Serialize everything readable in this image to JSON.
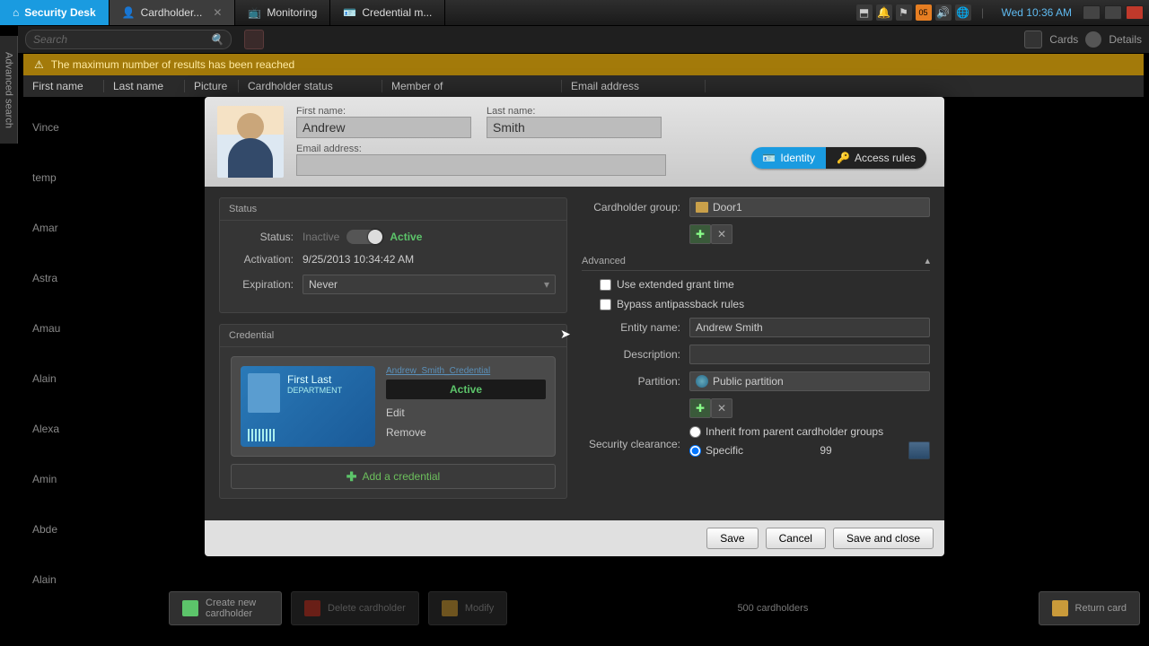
{
  "taskbar": {
    "home": "Security Desk",
    "tabs": [
      "Cardholder...",
      "Monitoring",
      "Credential m..."
    ],
    "clock": "Wed 10:36 AM"
  },
  "secondbar": {
    "search_placeholder": "Search",
    "cards": "Cards",
    "details": "Details"
  },
  "warning": "The maximum number of results has been reached",
  "sidebar": "Advanced search",
  "table": {
    "headers": [
      "First name",
      "Last name",
      "Picture",
      "Cardholder status",
      "Member of",
      "Email address"
    ],
    "rows": [
      "Vince",
      "temp",
      "Amar",
      "Astra",
      "Amau",
      "Alain",
      "Alexa",
      "Amin",
      "Abde",
      "Alain"
    ]
  },
  "modal": {
    "first_name_label": "First name:",
    "first_name": "Andrew",
    "last_name_label": "Last name:",
    "last_name": "Smith",
    "email_label": "Email address:",
    "email": "",
    "tab_identity": "Identity",
    "tab_access": "Access rules",
    "status_panel": "Status",
    "status_label": "Status:",
    "inactive": "Inactive",
    "active": "Active",
    "activation_label": "Activation:",
    "activation": "9/25/2013 10:34:42 AM",
    "expiration_label": "Expiration:",
    "expiration": "Never",
    "credential_panel": "Credential",
    "cred_link": "Andrew_Smith_Credential",
    "card_title": "First Last",
    "card_sub": "DEPARTMENT",
    "cred_status": "Active",
    "edit": "Edit",
    "remove": "Remove",
    "add_cred": "Add a credential",
    "group_label": "Cardholder group:",
    "group": "Door1",
    "advanced": "Advanced",
    "ext_grant": "Use extended grant time",
    "bypass": "Bypass antipassback rules",
    "entity_label": "Entity name:",
    "entity": "Andrew Smith",
    "desc_label": "Description:",
    "desc": "",
    "partition_label": "Partition:",
    "partition": "Public partition",
    "sec_label": "Security clearance:",
    "inherit": "Inherit from parent cardholder groups",
    "specific": "Specific",
    "specific_val": "99",
    "save": "Save",
    "cancel": "Cancel",
    "save_close": "Save and close"
  },
  "bottom": {
    "create": "Create new cardholder",
    "delete": "Delete cardholder",
    "modify": "Modify",
    "count": "500 cardholders",
    "return": "Return card"
  }
}
